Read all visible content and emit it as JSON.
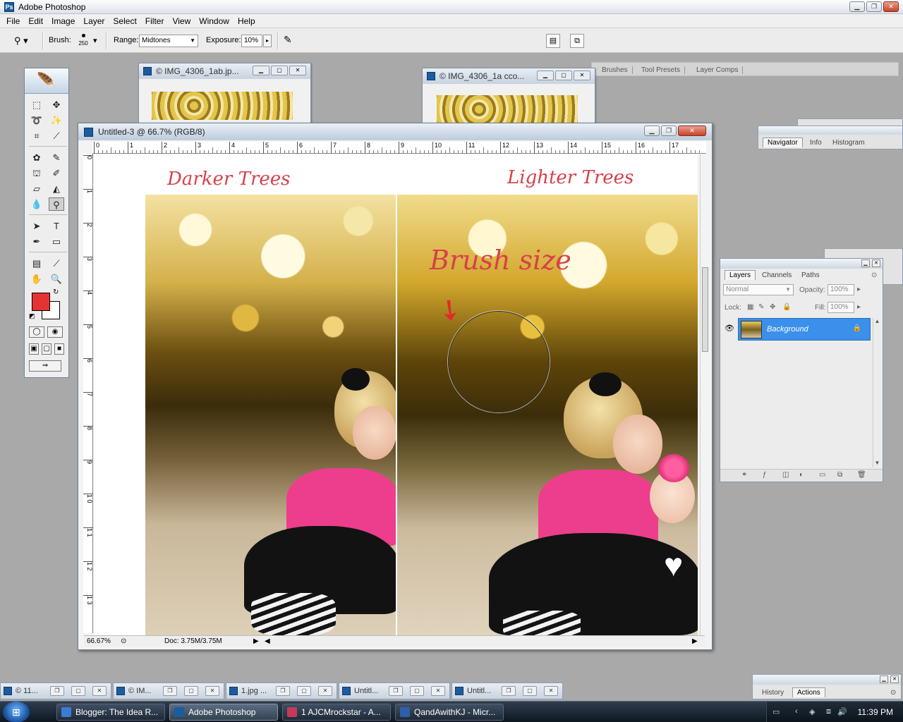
{
  "app": {
    "title": "Adobe Photoshop"
  },
  "menu": [
    "File",
    "Edit",
    "Image",
    "Layer",
    "Select",
    "Filter",
    "View",
    "Window",
    "Help"
  ],
  "options": {
    "brush_label": "Brush:",
    "brush_size": "250",
    "range_label": "Range:",
    "range_value": "Midtones",
    "exposure_label": "Exposure:",
    "exposure_value": "10%"
  },
  "palette_well": {
    "tabs": [
      "Brushes",
      "Tool Presets",
      "Layer Comps"
    ]
  },
  "bg_windows": [
    {
      "title": "© IMG_4306_1ab.jp..."
    },
    {
      "title": "© IMG_4306_1a cco..."
    }
  ],
  "document": {
    "title": "Untitled-3 @ 66.7% (RGB/8)",
    "ruler_h": [
      "0",
      "1",
      "2",
      "3",
      "4",
      "5",
      "6",
      "7",
      "8",
      "9",
      "10",
      "11",
      "12",
      "13",
      "14",
      "15",
      "16",
      "17"
    ],
    "ruler_v": [
      "0",
      "1",
      "2",
      "3",
      "4",
      "5",
      "6",
      "7",
      "8",
      "9",
      "1 0",
      "1 1",
      "1 2",
      "1 3"
    ],
    "label_left": "Darker Trees",
    "label_right": "Lighter Trees",
    "annotation": "Brush size",
    "zoom": "66.67%",
    "doc_size": "Doc: 3.75M/3.75M"
  },
  "navigator": {
    "tabs": [
      "Navigator",
      "Info",
      "Histogram"
    ]
  },
  "layers_panel": {
    "tabs": [
      "Layers",
      "Channels",
      "Paths"
    ],
    "blend_mode": "Normal",
    "opacity_label": "Opacity:",
    "opacity_value": "100%",
    "lock_label": "Lock:",
    "fill_label": "Fill:",
    "fill_value": "100%",
    "layer_name": "Background"
  },
  "history_panel": {
    "tabs": [
      "History",
      "Actions"
    ]
  },
  "minimized": [
    "© 11...",
    "© IM...",
    "1.jpg ...",
    "Untitl...",
    "Untitl..."
  ],
  "taskbar": {
    "items": [
      "Blogger: The Idea R...",
      "Adobe Photoshop",
      "1 AJCMrockstar - A...",
      "QandAwithKJ - Micr..."
    ],
    "clock": "11:39 PM"
  },
  "colors": {
    "foreground": "#e53232",
    "background": "#ffffff",
    "annotation": "#d8404a",
    "selected_layer": "#3a90ea"
  },
  "icons": {
    "tools": [
      "marquee-icon",
      "move-icon",
      "lasso-icon",
      "magic-wand-icon",
      "crop-icon",
      "slice-icon",
      "healing-icon",
      "brush-icon",
      "stamp-icon",
      "history-brush-icon",
      "eraser-icon",
      "bucket-icon",
      "blur-icon",
      "dodge-icon",
      "path-select-icon",
      "type-icon",
      "pen-icon",
      "shape-icon",
      "notes-icon",
      "eyedropper-icon",
      "hand-icon",
      "zoom-icon"
    ]
  }
}
